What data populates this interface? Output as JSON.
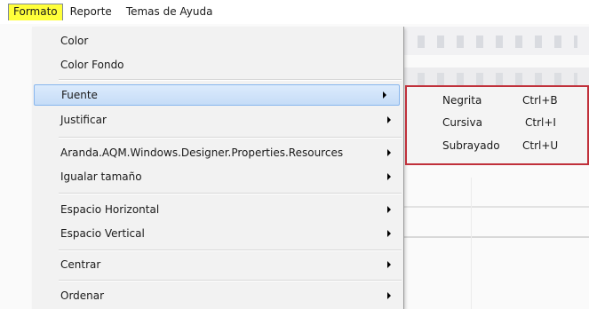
{
  "menubar": {
    "items": [
      {
        "label": "Formato"
      },
      {
        "label": "Reporte"
      },
      {
        "label": "Temas de Ayuda"
      }
    ],
    "active_color": "#ffff3a"
  },
  "dropdown": {
    "items": [
      {
        "label": "Color",
        "submenu": false
      },
      {
        "label": "Color Fondo",
        "submenu": false
      },
      {
        "label": "Fuente",
        "submenu": true,
        "selected": true
      },
      {
        "label": "Justificar",
        "submenu": true
      },
      {
        "label": "Aranda.AQM.Windows.Designer.Properties.Resources",
        "submenu": true
      },
      {
        "label": "Igualar tamaño",
        "submenu": true
      },
      {
        "label": "Espacio Horizontal",
        "submenu": true
      },
      {
        "label": "Espacio Vertical",
        "submenu": true
      },
      {
        "label": "Centrar",
        "submenu": true
      },
      {
        "label": "Ordenar",
        "submenu": true
      }
    ],
    "selected_color": "#c5dcf7"
  },
  "submenu": {
    "items": [
      {
        "label": "Negrita",
        "shortcut": "Ctrl+B"
      },
      {
        "label": "Cursiva",
        "shortcut": "Ctrl+I"
      },
      {
        "label": "Subrayado",
        "shortcut": "Ctrl+U"
      }
    ],
    "border_color": "#c0303a"
  },
  "icons": {
    "submenu_arrow": "chevron-right-icon"
  }
}
